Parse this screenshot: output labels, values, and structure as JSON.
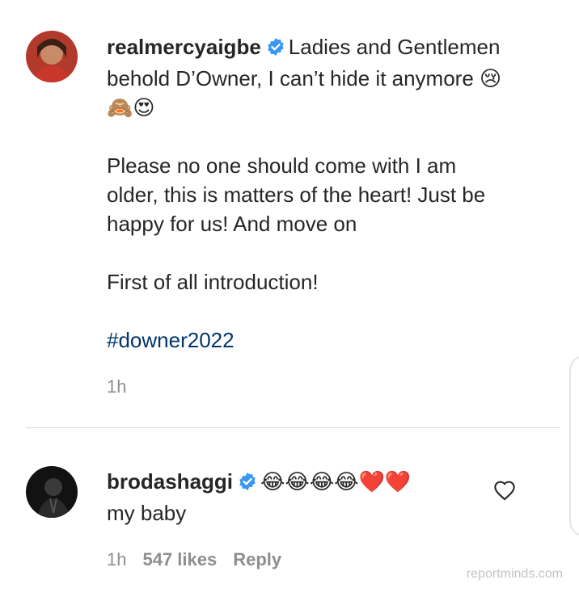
{
  "post": {
    "username": "realmercyaigbe",
    "caption_line1": "Ladies and Gentlemen behold D’Owner, I can’t hide it anymore",
    "caption_emojis": "😢🙈😍",
    "caption_para2": "Please no one should come with I am older, this is matters of the heart! Just be happy for us! And move on",
    "caption_para3": "First of all introduction!",
    "hashtag": "#downer2022",
    "time": "1h"
  },
  "comment": {
    "username": "brodashaggi",
    "emojis": "😂😂😂😂❤️❤️",
    "text": "my baby",
    "time": "1h",
    "likes": "547 likes",
    "reply_label": "Reply"
  },
  "watermark": "reportminds.com"
}
